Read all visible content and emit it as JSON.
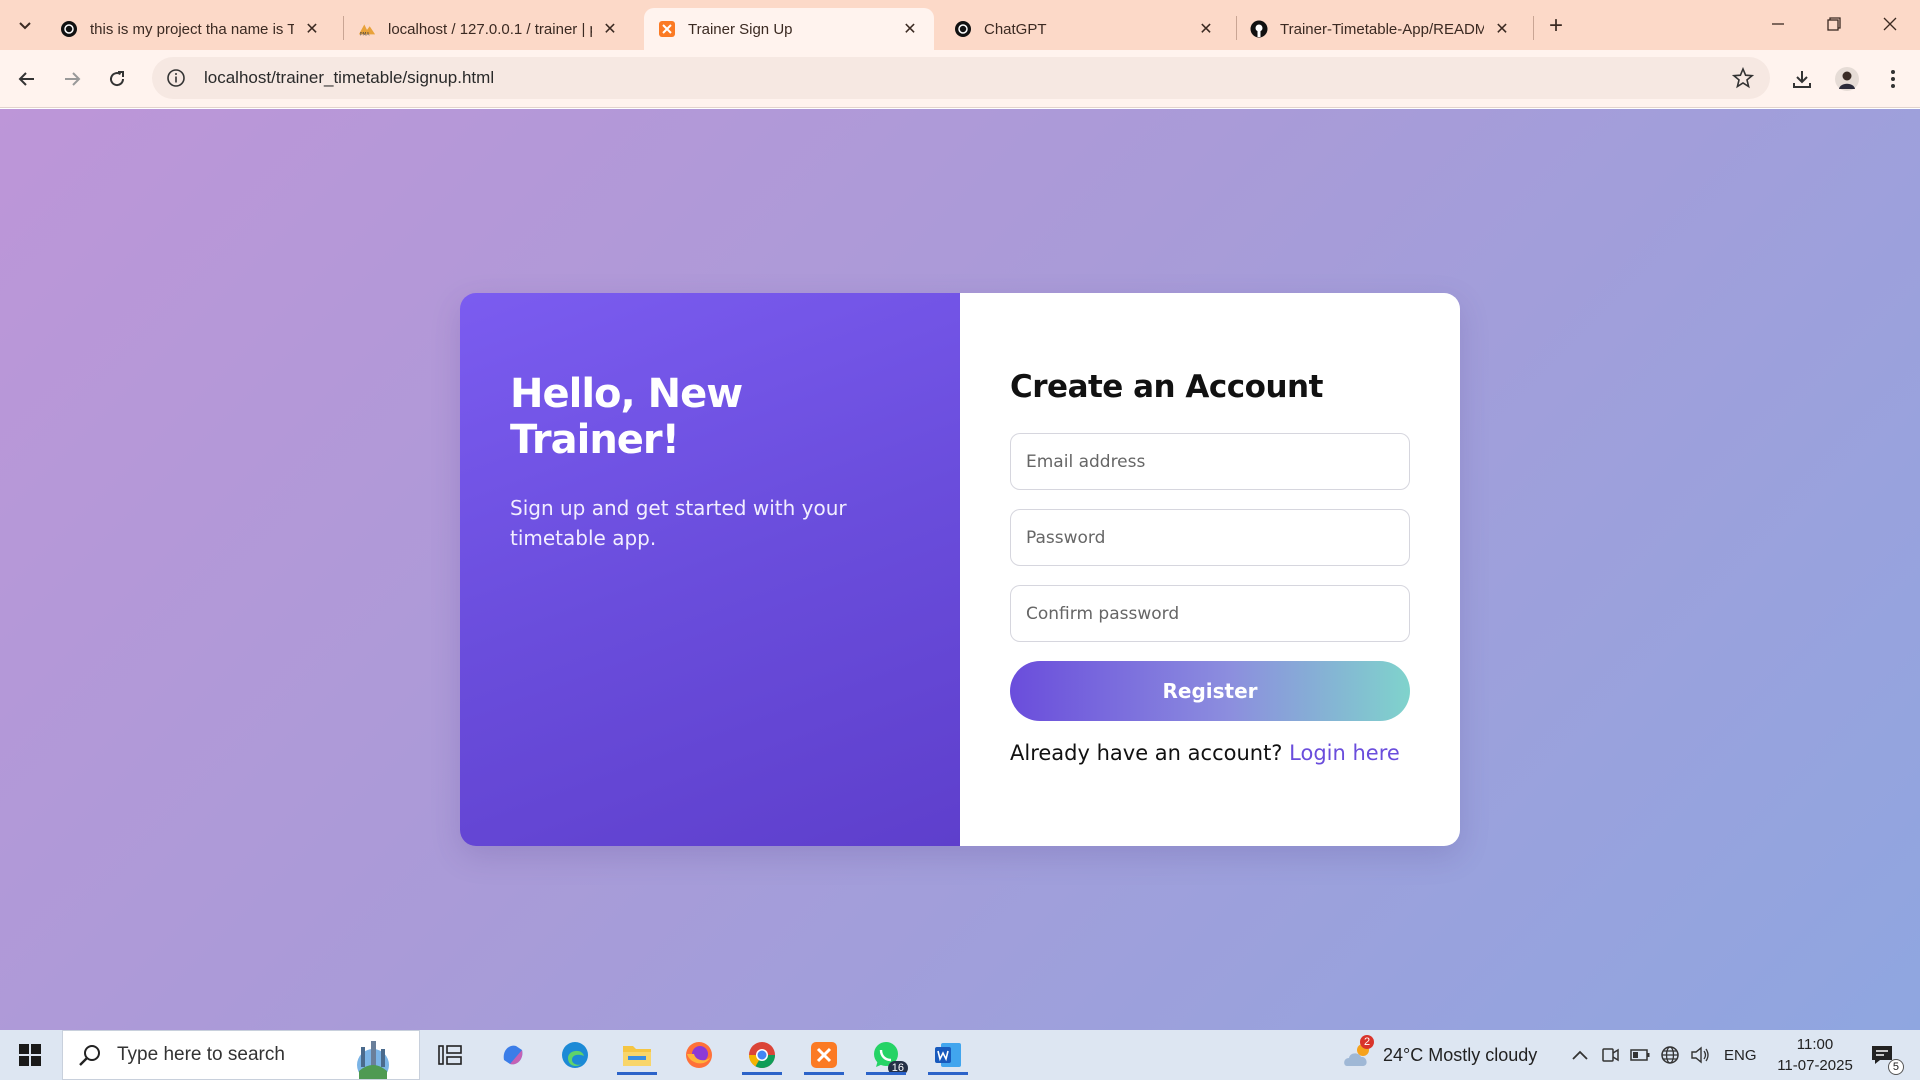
{
  "browser": {
    "tabs": [
      {
        "title": "this is my project tha name is Tr",
        "active": false
      },
      {
        "title": "localhost / 127.0.0.1 / trainer | p",
        "active": false
      },
      {
        "title": "Trainer Sign Up",
        "active": true
      },
      {
        "title": "ChatGPT",
        "active": false
      },
      {
        "title": "Trainer-Timetable-App/READM",
        "active": false
      }
    ],
    "url": "localhost/trainer_timetable/signup.html"
  },
  "page": {
    "welcome_title": "Hello, New Trainer!",
    "welcome_subtitle": "Sign up and get started with your timetable app.",
    "form_title": "Create an Account",
    "email_placeholder": "Email address",
    "password_placeholder": "Password",
    "confirm_placeholder": "Confirm password",
    "register_label": "Register",
    "login_prompt": "Already have an account?",
    "login_link": "Login here"
  },
  "taskbar": {
    "search_placeholder": "Type here to search",
    "whatsapp_badge": "16",
    "weather_badge": "2",
    "weather": "24°C  Mostly cloudy",
    "language": "ENG",
    "time": "11:00",
    "date": "11-07-2025",
    "notification_count": "5"
  },
  "colors": {
    "accent": "#6a4ddc",
    "tabbar": "#fcd9c8",
    "page_gradient_start": "#bd96d8",
    "page_gradient_end": "#8fa6e0"
  }
}
